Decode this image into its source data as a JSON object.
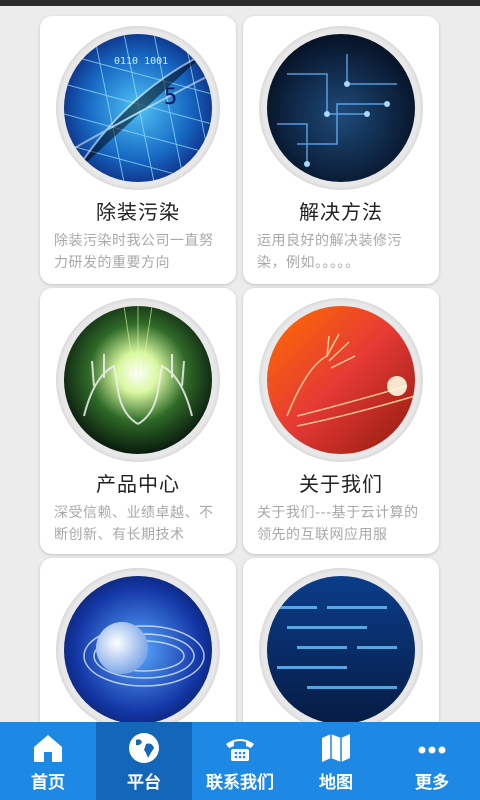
{
  "cards": [
    {
      "title": "除装污染",
      "description": "除装污染时我公司一直努力研发的重要方向",
      "image": "blue-data-grid-image"
    },
    {
      "title": "解决方法",
      "description": "运用良好的解决装修污染，例如。。。。。",
      "image": "circuit-board-image"
    },
    {
      "title": "产品中心",
      "description": "深受信赖、业绩卓越、不断创新、有长期技术",
      "image": "glowing-hands-image"
    },
    {
      "title": "关于我们",
      "description": "关于我们---基于云计算的领先的互联网应用服",
      "image": "orange-wireframe-hand-image"
    },
    {
      "title": "",
      "description": "",
      "image": "earth-globe-image"
    },
    {
      "title": "",
      "description": "",
      "image": "blue-data-stream-image"
    }
  ],
  "tabbar": {
    "active_index": 1,
    "items": [
      {
        "label": "首页",
        "icon": "home-icon"
      },
      {
        "label": "平台",
        "icon": "globe-icon"
      },
      {
        "label": "联系我们",
        "icon": "phone-icon"
      },
      {
        "label": "地图",
        "icon": "map-icon"
      },
      {
        "label": "更多",
        "icon": "more-icon"
      }
    ]
  },
  "colors": {
    "tabbar": "#1e88e5",
    "tabbar_active": "#1466b8",
    "background": "#ececec"
  }
}
